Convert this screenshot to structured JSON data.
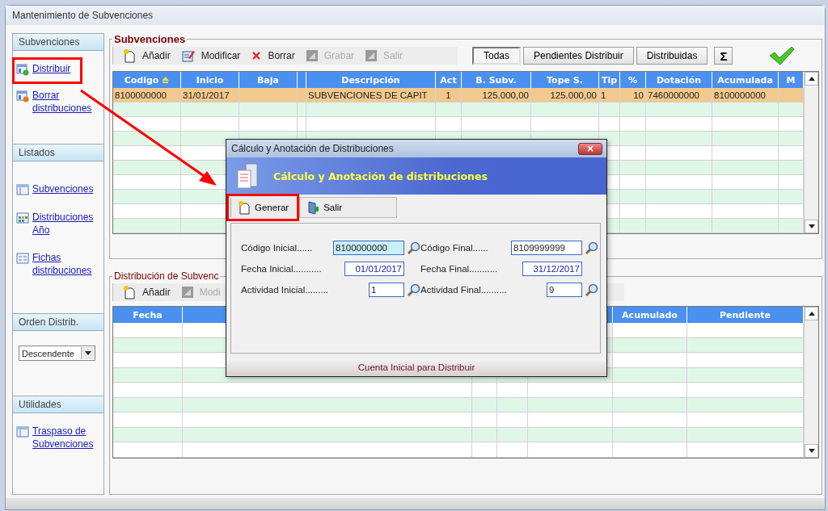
{
  "window": {
    "title": "Mantenimiento de Subvenciones"
  },
  "sidebar": {
    "sections": [
      {
        "title": "Subvenciones",
        "items": [
          {
            "label": "Distribuir"
          },
          {
            "label": "Borrar distribuciones"
          }
        ]
      },
      {
        "title": "Listados",
        "items": [
          {
            "label": "Subvenciones"
          },
          {
            "label": "Distribuciones Año"
          },
          {
            "label": "Fichas distribuciones"
          }
        ]
      },
      {
        "title": "Orden Distrib.",
        "select": {
          "value": "Descendente"
        }
      },
      {
        "title": "Utilidades",
        "items": [
          {
            "label": "Traspaso de Subvenciones"
          }
        ]
      }
    ]
  },
  "subvenciones": {
    "title": "Subvenciones",
    "toolbar": [
      {
        "label": "Añadir",
        "disabled": false
      },
      {
        "label": "Modificar",
        "disabled": false
      },
      {
        "label": "Borrar",
        "disabled": false
      },
      {
        "label": "Grabar",
        "disabled": true
      },
      {
        "label": "Salir",
        "disabled": true
      }
    ],
    "filters": [
      {
        "label": "Todas",
        "selected": true
      },
      {
        "label": "Pendientes Distribuir",
        "selected": false
      },
      {
        "label": "Distribuidas",
        "selected": false
      }
    ],
    "sum_button": "Σ",
    "table": {
      "columns": [
        {
          "label": "Codigo",
          "sorted": true
        },
        {
          "label": "Inicio",
          "sorted": false
        },
        {
          "label": "Baja",
          "sorted": false
        },
        {
          "sorted": false
        },
        {
          "label": "Descripción",
          "sorted": false
        },
        {
          "label": "Act",
          "sorted": false
        },
        {
          "label": "B. Subv.",
          "sorted": false
        },
        {
          "label": "Tope S.",
          "sorted": false
        },
        {
          "label": "Tip",
          "sorted": false
        },
        {
          "label": "%",
          "sorted": false
        },
        {
          "label": "Dotación",
          "sorted": false
        },
        {
          "label": "Acumulada",
          "sorted": false
        },
        {
          "label": "M",
          "sorted": false
        }
      ],
      "rows": [
        {
          "selected": true,
          "cells": [
            "8100000000",
            "31/01/2017",
            null,
            null,
            "SUBVENCIONES DE CAPIT",
            "1",
            "125.000,00",
            "125.000,00",
            "1",
            "10",
            "7460000000",
            "8100000000",
            null
          ]
        }
      ]
    }
  },
  "distribucion": {
    "title": "Distribución de Subvenc",
    "toolbar": [
      {
        "label": "Añadir",
        "disabled": false
      },
      {
        "label": "Modi",
        "disabled": true
      }
    ],
    "table": {
      "columns": [
        "Fecha",
        "Acumulado",
        "Pendiente"
      ]
    }
  },
  "dialog": {
    "title": "Cálculo y Anotación de Distribuciones",
    "close": "×",
    "banner": "Cálculo y Anotación de distribuciones",
    "buttons": [
      {
        "label": "Generar"
      },
      {
        "label": "Salir"
      }
    ],
    "fields": [
      [
        {
          "label": "Código Inicial......",
          "value": "8100000000",
          "kind": "code",
          "focused": true,
          "lookup": true
        },
        {
          "label": "Código Final......",
          "value": "8109999999",
          "kind": "code",
          "focused": false,
          "lookup": true
        }
      ],
      [
        {
          "label": "Fecha Inicial...........",
          "value": "01/01/2017",
          "kind": "date",
          "focused": false,
          "lookup": false
        },
        {
          "label": "Fecha Final...........",
          "value": "31/12/2017",
          "kind": "date",
          "focused": false,
          "lookup": false
        }
      ],
      [
        {
          "label": "Actividad Inicial.........",
          "value": "1",
          "kind": "number",
          "focused": false,
          "lookup": true
        },
        {
          "label": "Actividad Final..........",
          "value": "9",
          "kind": "number",
          "focused": false,
          "lookup": true
        }
      ]
    ],
    "status": "Cuenta Inicial para Distribuir"
  }
}
